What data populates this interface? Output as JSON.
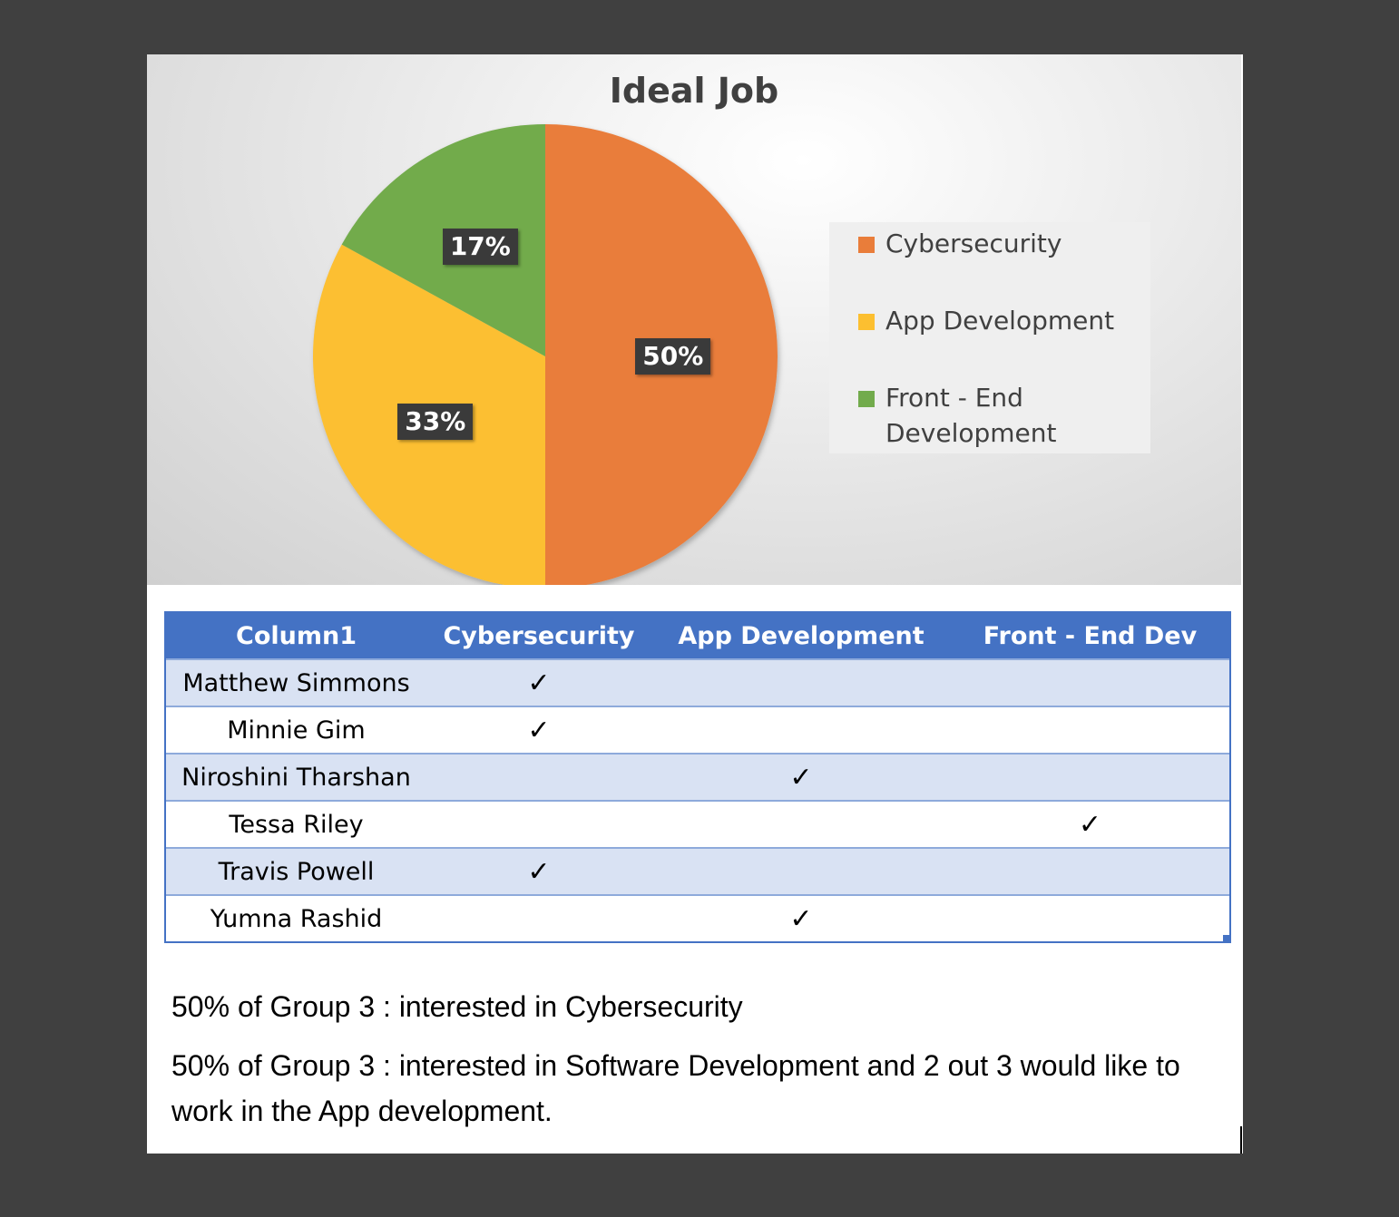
{
  "chart_data": {
    "type": "pie",
    "title": "Ideal Job",
    "categories": [
      "Cybersecurity",
      "App Development",
      "Front - End Development"
    ],
    "values": [
      50,
      33,
      17
    ],
    "data_labels": [
      "50%",
      "33%",
      "17%"
    ],
    "colors": [
      "#e97d3a",
      "#fcbf30",
      "#72ab4c"
    ],
    "legend_position": "right"
  },
  "legend": [
    {
      "label": "Cybersecurity",
      "color": "#e97d3a"
    },
    {
      "label": "App Development",
      "color": "#fcbf30"
    },
    {
      "label": "Front - End\nDevelopment",
      "color": "#72ab4c"
    }
  ],
  "table": {
    "headers": [
      "Column1",
      "Cybersecurity",
      "App Development",
      "Front - End Dev"
    ],
    "check_symbol": "✓",
    "rows": [
      {
        "name": "Matthew Simmons",
        "cyber": "✓",
        "app": "",
        "front": ""
      },
      {
        "name": "Minnie Gim",
        "cyber": "✓",
        "app": "",
        "front": ""
      },
      {
        "name": "Niroshini Tharshan",
        "cyber": "",
        "app": "✓",
        "front": ""
      },
      {
        "name": "Tessa Riley",
        "cyber": "",
        "app": "",
        "front": "✓"
      },
      {
        "name": "Travis Powell",
        "cyber": "✓",
        "app": "",
        "front": ""
      },
      {
        "name": "Yumna Rashid",
        "cyber": "",
        "app": "✓",
        "front": ""
      }
    ]
  },
  "notes": {
    "line1": "50% of Group 3 : interested in Cybersecurity",
    "line2": "50% of Group 3 : interested in Software Development and 2 out 3 would like to work in the App development."
  }
}
